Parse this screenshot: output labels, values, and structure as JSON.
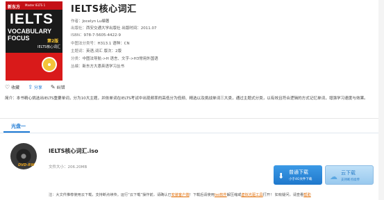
{
  "book": {
    "title": "IELTS核心词汇",
    "cover": {
      "publisher_mark": "新东方",
      "series": "Master IELTS 1",
      "brand": "IELTS",
      "subtitle_line1": "VOCABULARY",
      "subtitle_line2": "FOCUS",
      "edition": "第2版",
      "cn_title": "IELTS核心词汇"
    },
    "meta": [
      {
        "label": "作者：",
        "value": "Jocelyn Lu编著"
      },
      {
        "label": "出版社：",
        "value": "西安交通大学出版社 出版时间：2011.07"
      },
      {
        "label": "ISBN：",
        "value": "978-7-5605-4422-9"
      },
      {
        "label": "中图法分类号：",
        "value": "H313.1 语种：CN"
      },
      {
        "label": "主题词：",
        "value": "英语,词汇 版次：2版"
      },
      {
        "label": "分类：",
        "value": "中图法导航->H 语言、文字->H3常用外国语"
      },
      {
        "label": "丛编：",
        "value": "新东方大愚英语学习丛书"
      }
    ]
  },
  "actions": [
    {
      "icon": "♡",
      "label": "收藏"
    },
    {
      "icon": "⇪",
      "label": "分享"
    },
    {
      "icon": "✎",
      "label": "纠错"
    }
  ],
  "description": "简介：本书精心挑选出IELTS重要单词，分为10大主题，并依单词在IELTS考试中出现频率的高低分为低频、精选以及挑战单词三大类，通过主题式分类，以有效且符合逻辑的方式记忆单词，增强学习速度与效果。",
  "tab": {
    "label": "光盘一"
  },
  "file": {
    "name": "IELTS核心词汇.iso",
    "size": "文件大小：206.20MB",
    "disc_label": "DVD-RW"
  },
  "buttons": {
    "normal": {
      "label": "普通下载",
      "sub": "小于4G文件下载"
    },
    "resume": {
      "label": "云下载",
      "sub": "支持断点续传"
    }
  },
  "note": {
    "prefix": "注：大文件推荐使用云下载，支持断点续传。运行“云下载”操作前，请确认已",
    "link1": "安装客户端",
    "mid1": "！下载后请使用",
    "link2": "Iso软件",
    "mid2": "解压缩或",
    "link3": "虚拟光驱工具",
    "mid3": "打开！ 如有疑问，请查看",
    "link4": "帮助"
  }
}
